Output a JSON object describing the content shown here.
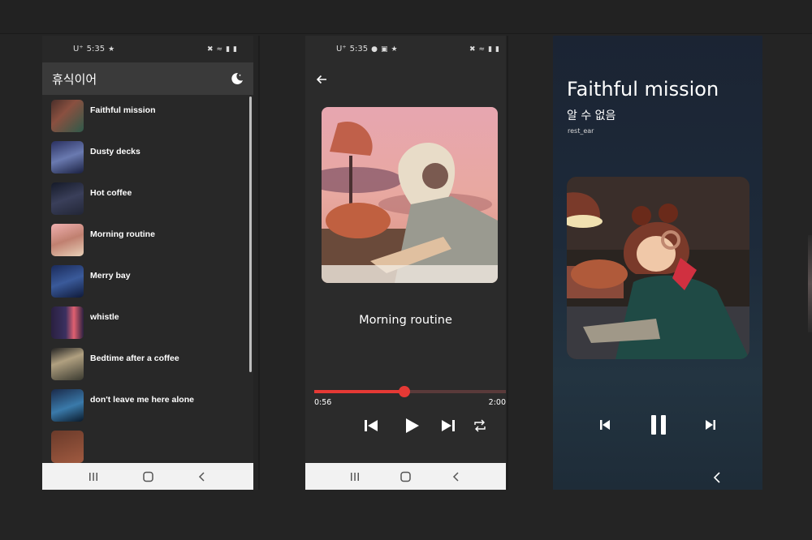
{
  "status_bar_1": {
    "carrier": "U⁺",
    "time": "5:35"
  },
  "status_bar_2": {
    "carrier": "U⁺",
    "time": "5:35"
  },
  "list_screen": {
    "app_title": "휴식이어",
    "theme_icon": "moon-icon",
    "items": [
      {
        "label": "Faithful mission",
        "colors": [
          "#3b2a2a",
          "#7a4a3a",
          "#2e5a4a"
        ]
      },
      {
        "label": "Dusty decks",
        "colors": [
          "#2a3060",
          "#5a6aa0",
          "#1a2040"
        ]
      },
      {
        "label": "Hot coffee",
        "colors": [
          "#1a1f2e",
          "#3a3f5a",
          "#2a2e40"
        ]
      },
      {
        "label": "Morning routine",
        "colors": [
          "#e8a0a0",
          "#c08070",
          "#f0d0c0"
        ]
      },
      {
        "label": "Merry bay",
        "colors": [
          "#1a2a5a",
          "#2a4a8a",
          "#101a3a"
        ]
      },
      {
        "label": "whistle",
        "colors": [
          "#2a2040",
          "#e06070",
          "#3a3060"
        ]
      },
      {
        "label": "Bedtime after a coffee",
        "colors": [
          "#2a2a2a",
          "#b0a080",
          "#4a4a3a"
        ]
      },
      {
        "label": "don't leave me here alone",
        "colors": [
          "#1a2a4a",
          "#3a6a9a",
          "#0a1a2a"
        ]
      }
    ]
  },
  "player_screen": {
    "song_title": "Morning routine",
    "current_time": "0:56",
    "total_time": "2:00",
    "progress_fraction": 0.47,
    "accent": "#e53935"
  },
  "now_playing_screen": {
    "song_title": "Faithful mission",
    "artist": "알 수 없음",
    "channel": "rest_ear"
  }
}
